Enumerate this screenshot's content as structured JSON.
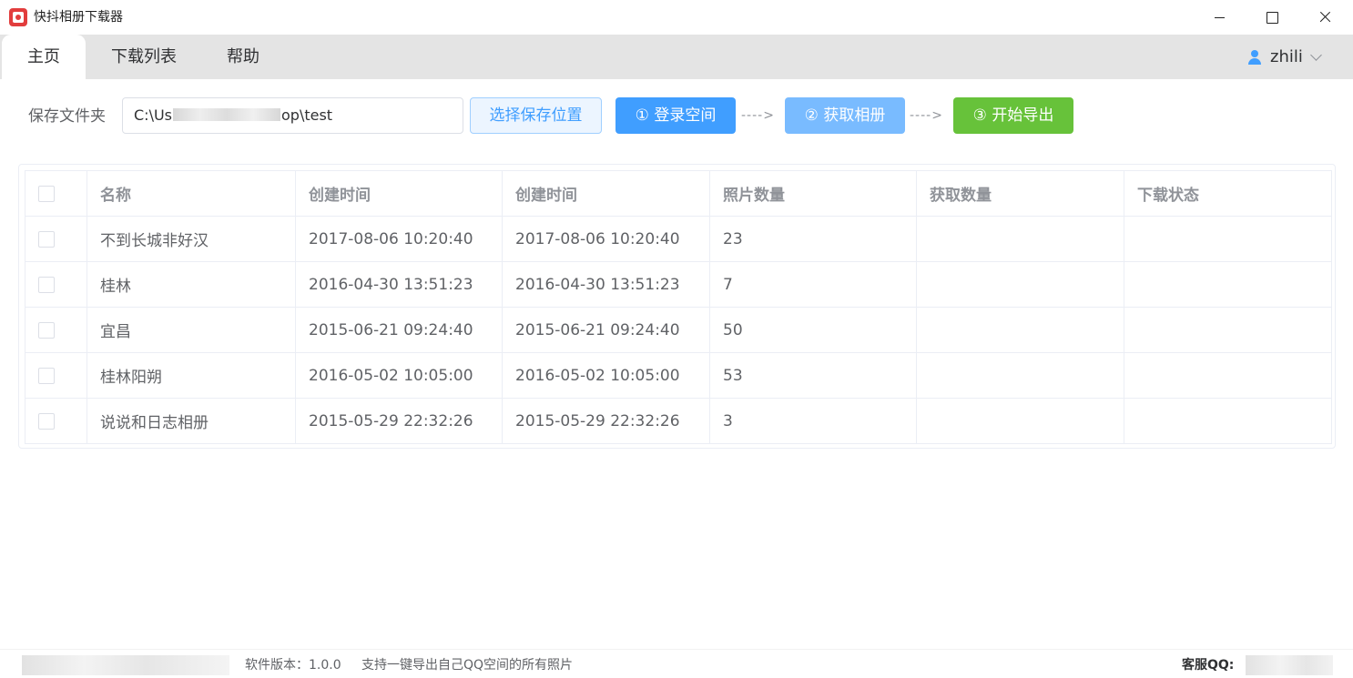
{
  "window": {
    "title": "快抖相册下载器"
  },
  "tabs": [
    {
      "label": "主页",
      "active": true
    },
    {
      "label": "下载列表",
      "active": false
    },
    {
      "label": "帮助",
      "active": false
    }
  ],
  "user": {
    "name": "zhili",
    "icon": "user-icon"
  },
  "toolbar": {
    "folder_label": "保存文件夹",
    "path_prefix": "C:\\Us",
    "path_suffix": "op\\test",
    "choose_button": "选择保存位置",
    "step1": "① 登录空间",
    "step2": "② 获取相册",
    "step3": "③ 开始导出",
    "arrow": "---->",
    "colors": {
      "primary": "#409eff",
      "disabled": "#79bbff",
      "success": "#67c23a"
    }
  },
  "table": {
    "headers": [
      "名称",
      "创建时间",
      "创建时间",
      "照片数量",
      "获取数量",
      "下载状态"
    ],
    "rows": [
      {
        "name": "不到长城非好汉",
        "created": "2017-08-06 10:20:40",
        "created2": "2017-08-06 10:20:40",
        "photos": "23",
        "fetched": "",
        "status": ""
      },
      {
        "name": "桂林",
        "created": "2016-04-30 13:51:23",
        "created2": "2016-04-30 13:51:23",
        "photos": "7",
        "fetched": "",
        "status": ""
      },
      {
        "name": "宜昌",
        "created": "2015-06-21 09:24:40",
        "created2": "2015-06-21 09:24:40",
        "photos": "50",
        "fetched": "",
        "status": ""
      },
      {
        "name": "桂林阳朔",
        "created": "2016-05-02 10:05:00",
        "created2": "2016-05-02 10:05:00",
        "photos": "53",
        "fetched": "",
        "status": ""
      },
      {
        "name": "说说和日志相册",
        "created": "2015-05-29 22:32:26",
        "created2": "2015-05-29 22:32:26",
        "photos": "3",
        "fetched": "",
        "status": ""
      }
    ]
  },
  "footer": {
    "version": "软件版本：1.0.0",
    "slogan": "支持一键导出自己QQ空间的所有照片",
    "qq_label": "客服QQ:"
  }
}
